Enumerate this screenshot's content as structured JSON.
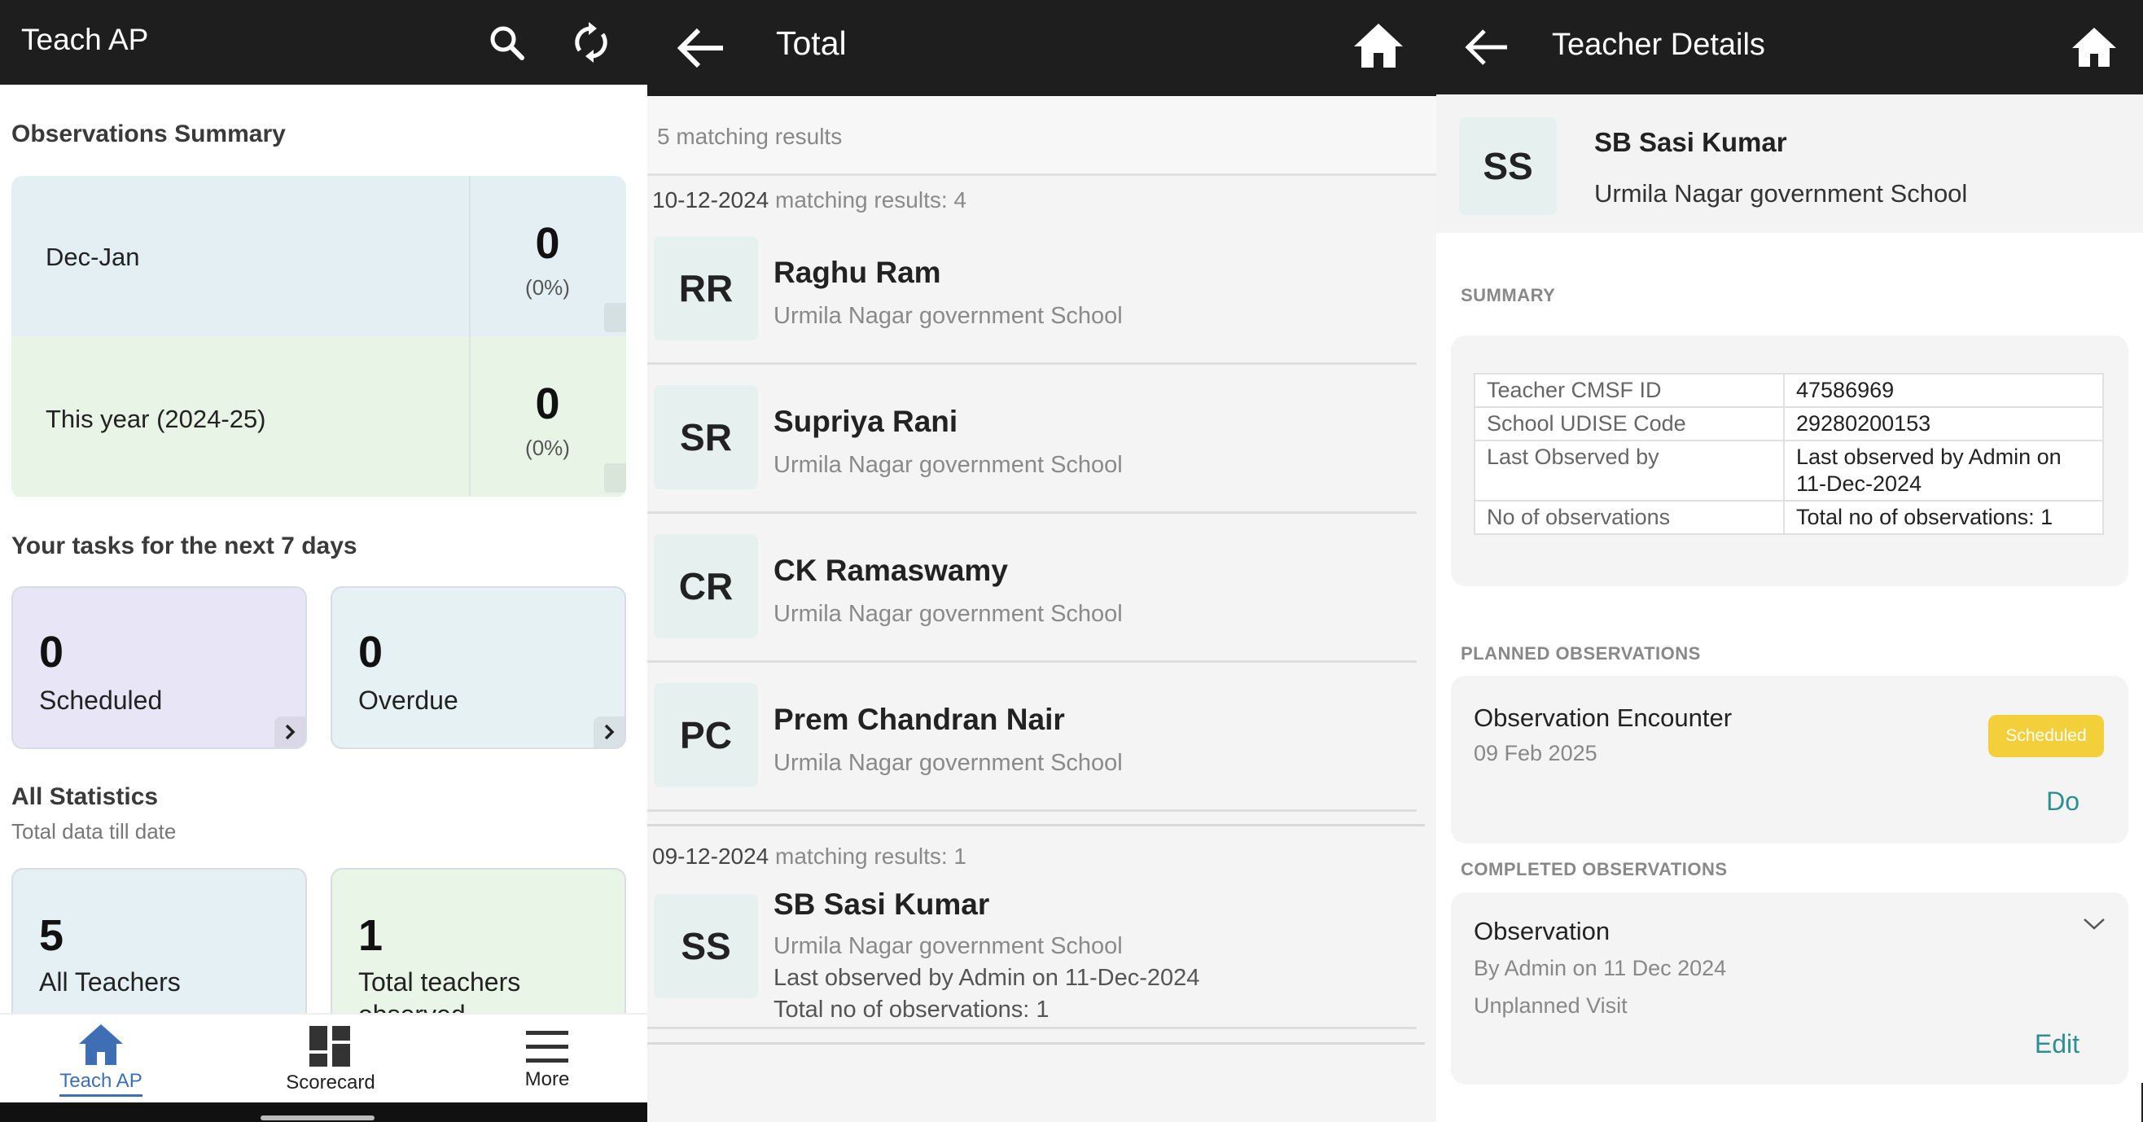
{
  "panel1": {
    "title": "Teach AP",
    "obs_summary_heading": "Observations Summary",
    "obs_rows": [
      {
        "label": "Dec-Jan",
        "value": "0",
        "percent": "(0%)",
        "color": "#e3eff2"
      },
      {
        "label": "This year (2024-25)",
        "value": "0",
        "percent": "(0%)",
        "color": "#e7f4e6"
      }
    ],
    "tasks_heading": "Your tasks for the next 7 days",
    "tasks": [
      {
        "value": "0",
        "label": "Scheduled",
        "color": "#e8e5f6"
      },
      {
        "value": "0",
        "label": "Overdue",
        "color": "#e6f1f3"
      }
    ],
    "stats_heading": "All Statistics",
    "stats_sub": "Total data till date",
    "stats": [
      {
        "value": "5",
        "label": "All Teachers",
        "color": "#e5f0f4"
      },
      {
        "value": "1",
        "label": "Total teachers observed",
        "color": "#e9f5e6"
      }
    ],
    "nav": [
      {
        "label": "Teach AP",
        "icon": "home-icon",
        "active": true
      },
      {
        "label": "Scorecard",
        "icon": "dashboard-icon",
        "active": false
      },
      {
        "label": "More",
        "icon": "menu-icon",
        "active": false
      }
    ]
  },
  "panel2": {
    "title": "Total",
    "matching": "5 matching results",
    "groups": [
      {
        "date": "10-12-2024",
        "count_text": "matching results: 4",
        "teachers": [
          {
            "initials": "RR",
            "name": "Raghu Ram",
            "school": "Urmila Nagar government School"
          },
          {
            "initials": "SR",
            "name": "Supriya Rani",
            "school": "Urmila Nagar government School"
          },
          {
            "initials": "CR",
            "name": "CK Ramaswamy",
            "school": "Urmila Nagar government School"
          },
          {
            "initials": "PC",
            "name": "Prem Chandran Nair",
            "school": "Urmila Nagar government School"
          }
        ]
      },
      {
        "date": "09-12-2024",
        "count_text": "matching results: 1",
        "teachers": [
          {
            "initials": "SS",
            "name": "SB Sasi Kumar",
            "school": "Urmila Nagar government School",
            "last_observed": "Last observed by Admin on 11-Dec-2024",
            "total_obs": "Total no of observations: 1"
          }
        ]
      }
    ]
  },
  "panel3": {
    "title": "Teacher Details",
    "initials": "SS",
    "name": "SB Sasi Kumar",
    "school": "Urmila Nagar government School",
    "summary_caption": "SUMMARY",
    "summary": [
      {
        "key": "Teacher CMSF ID",
        "value": "47586969"
      },
      {
        "key": "School UDISE Code",
        "value": "29280200153"
      },
      {
        "key": "Last Observed by",
        "value": "Last observed by Admin on 11-Dec-2024"
      },
      {
        "key": "No of observations",
        "value": "Total no of observations: 1"
      }
    ],
    "planned_caption": "PLANNED OBSERVATIONS",
    "planned": {
      "title": "Observation Encounter",
      "date": "09 Feb 2025",
      "badge": "Scheduled",
      "action": "Do"
    },
    "completed_caption": "COMPLETED OBSERVATIONS",
    "completed": {
      "title": "Observation",
      "by": "By Admin on 11 Dec 2024",
      "type": "Unplanned Visit",
      "action": "Edit"
    }
  }
}
